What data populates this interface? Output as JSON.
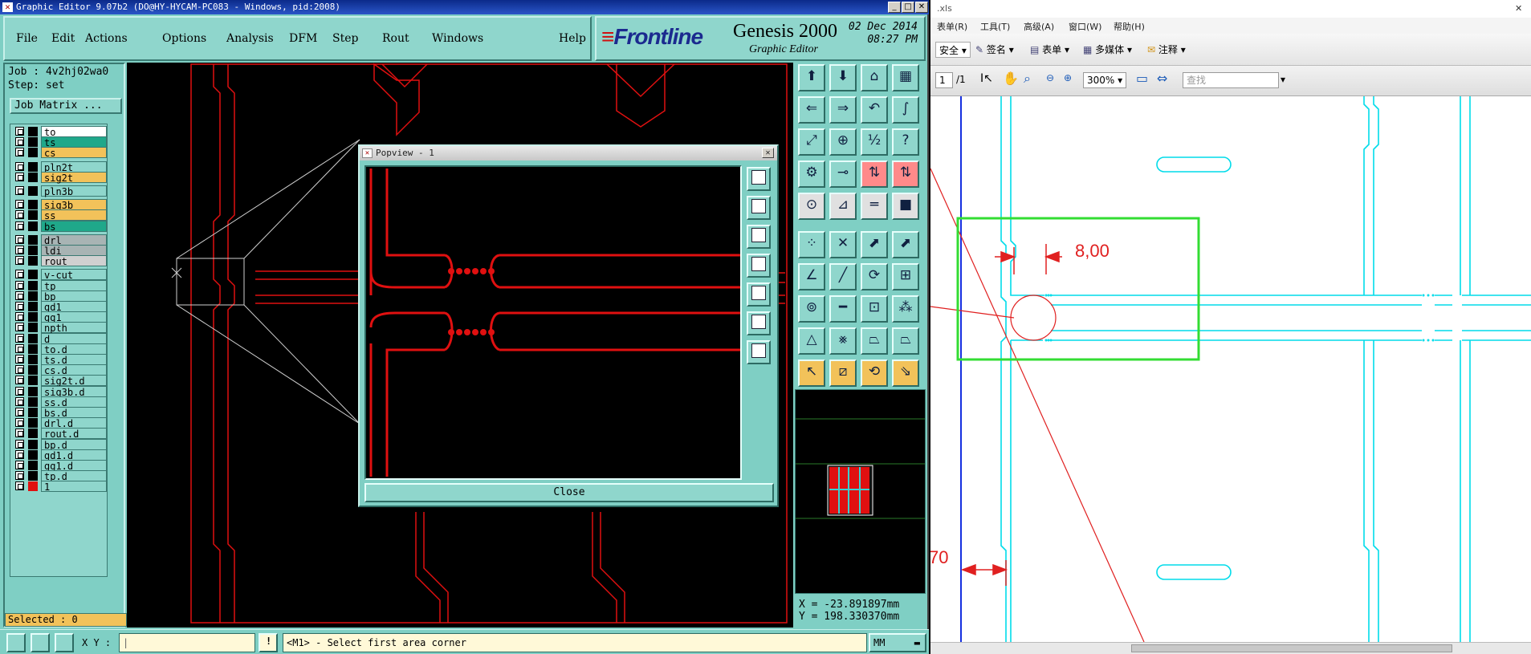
{
  "genesis": {
    "title": "Graphic Editor 9.07b2 (DO@HY-HYCAM-PC083 - Windows, pid:2008)",
    "menu": [
      "File",
      "Edit",
      "Actions",
      "Options",
      "Analysis",
      "DFM",
      "Step",
      "Rout",
      "Windows"
    ],
    "help": "Help",
    "brand": {
      "logo": "Frontline",
      "product": "Genesis 2000",
      "subtitle": "Graphic Editor",
      "date": "02 Dec 2014",
      "time": "08:27 PM"
    },
    "job_label": "Job : 4v2hj02wa0",
    "step_label": "Step: set",
    "job_matrix": "Job Matrix ...",
    "layers": [
      {
        "name": "to",
        "color": "#ffffff"
      },
      {
        "name": "ts",
        "color": "#1fa88a"
      },
      {
        "name": "cs",
        "color": "#f2c25a"
      },
      {
        "name": "pln2t",
        "color": "#8fd6cc"
      },
      {
        "name": "sig2t",
        "color": "#f2c25a"
      },
      {
        "name": "pln3b",
        "color": "#8fd6cc"
      },
      {
        "name": "sig3b",
        "color": "#f2c25a"
      },
      {
        "name": "ss",
        "color": "#f2c25a"
      },
      {
        "name": "bs",
        "color": "#1fa88a"
      },
      {
        "name": "drl",
        "color": "#a8b4b4"
      },
      {
        "name": "ldi",
        "color": "#a8b4b4"
      },
      {
        "name": "rout",
        "color": "#d0d0d0"
      },
      {
        "name": "v-cut",
        "color": "#8fd6cc"
      },
      {
        "name": "tp",
        "color": "#8fd6cc"
      },
      {
        "name": "bp",
        "color": "#8fd6cc"
      },
      {
        "name": "gd1",
        "color": "#8fd6cc"
      },
      {
        "name": "gg1",
        "color": "#8fd6cc"
      },
      {
        "name": "npth",
        "color": "#8fd6cc"
      },
      {
        "name": "d",
        "color": "#8fd6cc"
      },
      {
        "name": "to.d",
        "color": "#8fd6cc"
      },
      {
        "name": "ts.d",
        "color": "#8fd6cc"
      },
      {
        "name": "cs.d",
        "color": "#8fd6cc"
      },
      {
        "name": "sig2t.d",
        "color": "#8fd6cc"
      },
      {
        "name": "sig3b.d",
        "color": "#8fd6cc"
      },
      {
        "name": "ss.d",
        "color": "#8fd6cc"
      },
      {
        "name": "bs.d",
        "color": "#8fd6cc"
      },
      {
        "name": "drl.d",
        "color": "#8fd6cc"
      },
      {
        "name": "rout.d",
        "color": "#8fd6cc"
      },
      {
        "name": "bp.d",
        "color": "#8fd6cc"
      },
      {
        "name": "gd1.d",
        "color": "#8fd6cc"
      },
      {
        "name": "gg1.d",
        "color": "#8fd6cc"
      },
      {
        "name": "tp.d",
        "color": "#8fd6cc"
      },
      {
        "name": "1",
        "color": "#8fd6cc"
      }
    ],
    "selected": "Selected : 0",
    "coords": {
      "x": "X = -23.891897mm",
      "y": "Y = 198.330370mm"
    },
    "xy_label": "X Y :",
    "message": "<M1> - Select first area corner",
    "units": "MM",
    "popview": {
      "title": "Popview - 1",
      "close": "Close"
    }
  },
  "pdf": {
    "title": ".xls",
    "menu": [
      "表单(R)",
      "工具(T)",
      "高级(A)",
      "窗口(W)",
      "帮助(H)"
    ],
    "toolbar": [
      "安全",
      "签名",
      "表单",
      "多媒体",
      "注释"
    ],
    "page_input": "1",
    "page_total": "/1",
    "zoom": "300%",
    "search_placeholder": "查找",
    "dim_label": "8,00",
    "dim_label2": "70"
  },
  "colors": {
    "accent_red": "#ff0000",
    "cyan": "#00e5f0",
    "highlight_green": "#33dd33"
  }
}
